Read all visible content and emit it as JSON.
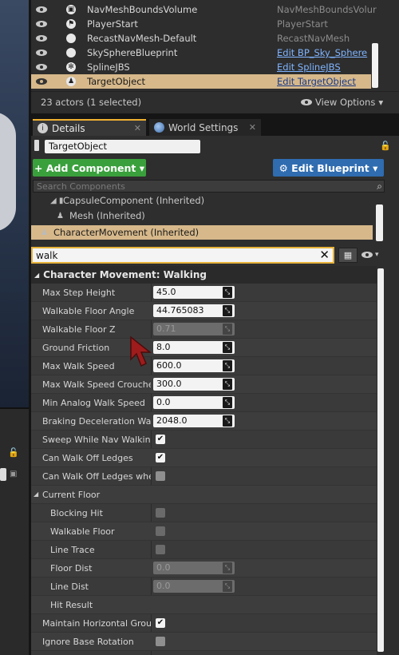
{
  "outliner": {
    "rows": [
      {
        "name": "NavMeshBoundsVolume",
        "type": "NavMeshBoundsVolur",
        "link": false,
        "icon": "cube-icon"
      },
      {
        "name": "PlayerStart",
        "type": "PlayerStart",
        "link": false,
        "icon": "flag-icon"
      },
      {
        "name": "RecastNavMesh-Default",
        "type": "RecastNavMesh",
        "link": false,
        "icon": "sphere-icon"
      },
      {
        "name": "SkySphereBlueprint",
        "type": "Edit BP_Sky_Sphere",
        "link": true,
        "icon": "sphere-icon"
      },
      {
        "name": "SplineJBS",
        "type": "Edit SplineJBS",
        "link": true,
        "icon": "spline-icon"
      },
      {
        "name": "TargetObject",
        "type": "Edit TargetObject",
        "link": true,
        "icon": "character-icon",
        "selected": true
      }
    ],
    "status": "23 actors (1 selected)",
    "view_options": "View Options"
  },
  "tabs": {
    "details": "Details",
    "world_settings": "World Settings"
  },
  "details": {
    "actor_name": "TargetObject",
    "add_component": "+ Add Component",
    "edit_blueprint": "Edit Blueprint",
    "component_search_placeholder": "Search Components",
    "components": [
      {
        "label": "CapsuleComponent (Inherited)"
      },
      {
        "label": "Mesh (Inherited)"
      },
      {
        "label": "CharacterMovement (Inherited)",
        "selected": true
      }
    ],
    "filter_value": "walk",
    "category": "Character Movement: Walking",
    "properties": [
      {
        "label": "Max Step Height",
        "kind": "number",
        "value": "45.0"
      },
      {
        "label": "Walkable Floor Angle",
        "kind": "number",
        "value": "44.765083"
      },
      {
        "label": "Walkable Floor Z",
        "kind": "number",
        "value": "0.71",
        "disabled": true
      },
      {
        "label": "Ground Friction",
        "kind": "number",
        "value": "8.0"
      },
      {
        "label": "Max Walk Speed",
        "kind": "number",
        "value": "600.0"
      },
      {
        "label": "Max Walk Speed Crouched",
        "kind": "number",
        "value": "300.0"
      },
      {
        "label": "Min Analog Walk Speed",
        "kind": "number",
        "value": "0.0"
      },
      {
        "label": "Braking Deceleration Walkin",
        "kind": "number",
        "value": "2048.0"
      },
      {
        "label": "Sweep While Nav Walking",
        "kind": "check",
        "checked": true
      },
      {
        "label": "Can Walk Off Ledges",
        "kind": "check",
        "checked": true
      },
      {
        "label": "Can Walk Off Ledges when C",
        "kind": "check",
        "checked": false
      },
      {
        "label": "Current Floor",
        "kind": "group"
      },
      {
        "label": "Blocking Hit",
        "kind": "check",
        "checked": false,
        "disabled": true,
        "indent": true
      },
      {
        "label": "Walkable Floor",
        "kind": "check",
        "checked": false,
        "disabled": true,
        "indent": true
      },
      {
        "label": "Line Trace",
        "kind": "check",
        "checked": false,
        "disabled": true,
        "indent": true
      },
      {
        "label": "Floor Dist",
        "kind": "number",
        "value": "0.0",
        "disabled": true,
        "indent": true
      },
      {
        "label": "Line Dist",
        "kind": "number",
        "value": "0.0",
        "disabled": true,
        "indent": true
      },
      {
        "label": "Hit Result",
        "kind": "label",
        "indent": true
      },
      {
        "label": "Maintain Horizontal Ground",
        "kind": "check",
        "checked": true
      },
      {
        "label": "Ignore Base Rotation",
        "kind": "check",
        "checked": false
      }
    ]
  }
}
